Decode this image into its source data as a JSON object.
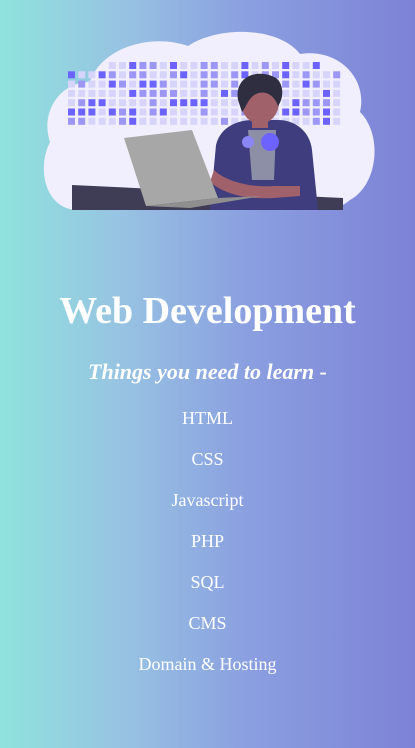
{
  "hero": {
    "illustration": "web-developer-illustration",
    "colors": {
      "cloud": "#f1effd",
      "tile_dark": "#6c63ff",
      "tile_mid": "#9c96f5",
      "tile_light": "#d7d4fb",
      "jacket": "#3f3d7e",
      "laptop": "#a7a7a7",
      "desk": "#3f3d56",
      "skin": "#a0616a"
    }
  },
  "page": {
    "title": "Web Development",
    "subtitle": "Things you need to learn -"
  },
  "topics": [
    "HTML",
    "CSS",
    "Javascript",
    "PHP",
    "SQL",
    "CMS",
    "Domain & Hosting"
  ]
}
